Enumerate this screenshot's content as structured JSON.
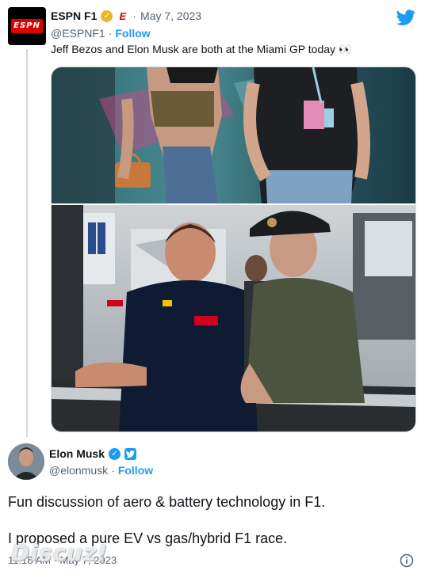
{
  "quoted_tweet": {
    "display_name": "ESPN F1",
    "handle": "@ESPNF1",
    "date": "May 7, 2023",
    "separator": "·",
    "follow_label": "Follow",
    "text": "Jeff Bezos and Elon Musk are both at the Miami GP today 👀",
    "avatar_text": "ESPN",
    "badge_icon": "gold-verified-icon",
    "affiliate_icon": "espn-e-icon"
  },
  "main_tweet": {
    "display_name": "Elon Musk",
    "handle": "@elonmusk",
    "separator": "·",
    "follow_label": "Follow",
    "text_line_1": "Fun discussion of aero & battery technology in F1.",
    "text_line_2": "I proposed a pure EV vs gas/hybrid F1 race.",
    "timestamp": "11:18 AM · May 7, 2023",
    "badge_icon": "blue-verified-icon"
  },
  "watermark": "Discuz!",
  "colors": {
    "accent": "#1d9bf0",
    "gold": "#e8b829",
    "espn_red": "#dd0000",
    "text": "#0f1419",
    "muted": "#536471"
  }
}
